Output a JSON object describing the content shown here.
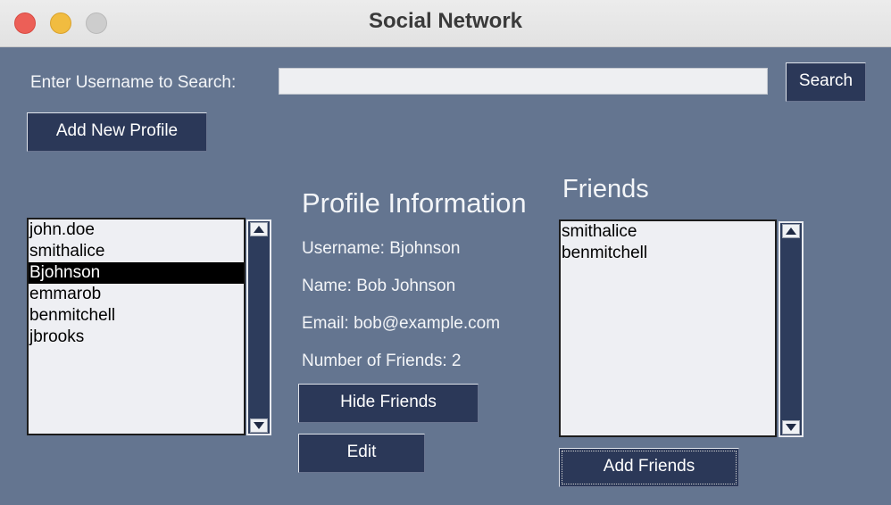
{
  "window": {
    "title": "Social Network"
  },
  "search": {
    "label": "Enter Username to Search:",
    "value": "",
    "placeholder": "",
    "button_label": "Search"
  },
  "actions": {
    "add_profile_label": "Add New Profile"
  },
  "users": {
    "items": [
      "john.doe",
      "smithalice",
      "Bjohnson",
      "emmarob",
      "benmitchell",
      "jbrooks"
    ],
    "selected": "Bjohnson"
  },
  "profile": {
    "heading": "Profile Information",
    "username": "Username: Bjohnson",
    "name": "Name: Bob Johnson",
    "email": "Email: bob@example.com",
    "friend_count": "Number of Friends: 2",
    "hide_friends_label": "Hide Friends",
    "edit_label": "Edit"
  },
  "friends": {
    "heading": "Friends",
    "items": [
      "smithalice",
      "benmitchell"
    ],
    "add_label": "Add Friends"
  },
  "icons": {
    "close": "close-window-icon",
    "minimize": "minimize-window-icon",
    "zoom": "zoom-window-icon",
    "scroll_up": "triangle-up-icon",
    "scroll_down": "triangle-down-icon"
  },
  "colors": {
    "background": "#647590",
    "button": "#2b3858",
    "selection": "#000000"
  }
}
